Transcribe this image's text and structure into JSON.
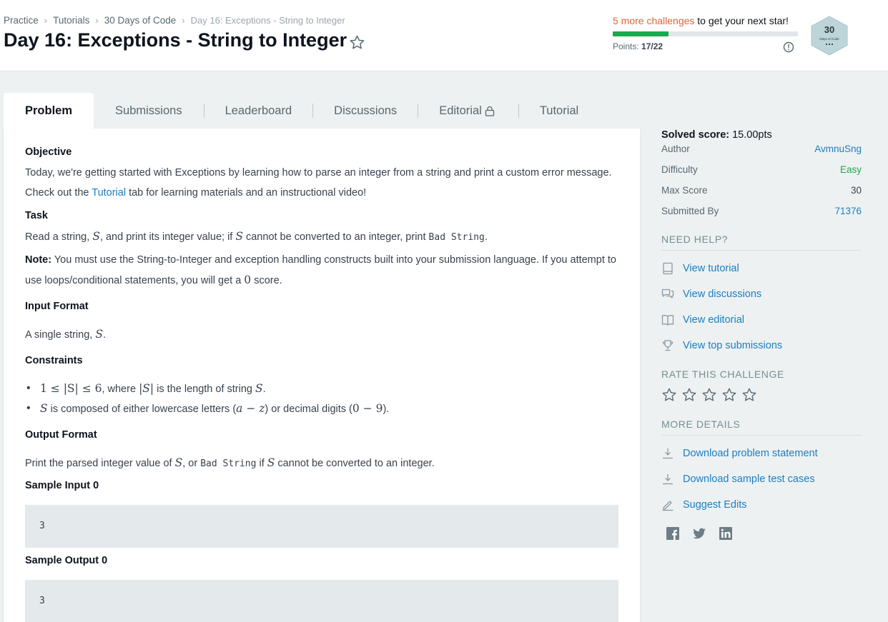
{
  "breadcrumb": [
    "Practice",
    "Tutorials",
    "30 Days of Code",
    "Day 16: Exceptions - String to Integer"
  ],
  "page_title": "Day 16: Exceptions - String to Integer",
  "star_progress": {
    "highlight": "5 more challenges",
    "rest": " to get your next star!",
    "points_label": "Points:",
    "points_value": "17/22",
    "fraction": 0.3
  },
  "badge": {
    "number": "30",
    "caption": "Days of Code"
  },
  "tabs": [
    "Problem",
    "Submissions",
    "Leaderboard",
    "Discussions",
    "Editorial",
    "Tutorial"
  ],
  "problem": {
    "objective_heading": "Objective",
    "objective_text_1": "Today, we're getting started with Exceptions by learning how to parse an integer from a string and print a custom error message. Check out the ",
    "objective_link": "Tutorial",
    "objective_text_2": " tab for learning materials and an instructional video!",
    "task_heading": "Task",
    "task_a": "Read a string, ",
    "task_s1": "S",
    "task_b": ", and print its integer value; if ",
    "task_s2": "S",
    "task_c": " cannot be converted to an integer, print ",
    "task_code": "Bad String",
    "task_d": ".",
    "note_label": "Note:",
    "note_a": " You must use the String-to-Integer and exception handling constructs built into your submission language. If you attempt to use loops/conditional statements, you will get a ",
    "note_zero": "0",
    "note_b": " score.",
    "input_heading": "Input Format",
    "input_a": "A single string, ",
    "input_s": "S",
    "input_b": ".",
    "constraints_heading": "Constraints",
    "c1_math": "1 ≤ |S| ≤ 6",
    "c1_a": ", where ",
    "c1_abs": "|S|",
    "c1_b": " is the length of string ",
    "c1_s": "S",
    "c1_c": ".",
    "c2_s": "S",
    "c2_a": " is composed of either lowercase letters (",
    "c2_m1": "a − z",
    "c2_b": ") or decimal digits (",
    "c2_m2": "0 − 9",
    "c2_c": ").",
    "output_heading": "Output Format",
    "out_a": "Print the parsed integer value of ",
    "out_s1": "S",
    "out_b": ", or ",
    "out_code": "Bad String",
    "out_c": " if ",
    "out_s2": "S",
    "out_d": " cannot be converted to an integer.",
    "sample_input_heading": "Sample Input 0",
    "sample_input": "3",
    "sample_output_heading": "Sample Output 0",
    "sample_output": "3"
  },
  "sidebar": {
    "solved_label": "Solved score:",
    "solved_value": " 15.00pts",
    "meta": [
      {
        "label": "Author",
        "value": "AvmnuSng",
        "style": "link"
      },
      {
        "label": "Difficulty",
        "value": "Easy",
        "style": "easy"
      },
      {
        "label": "Max Score",
        "value": "30",
        "style": "plain"
      },
      {
        "label": "Submitted By",
        "value": "71376",
        "style": "link"
      }
    ],
    "need_help": "NEED HELP?",
    "help_links": [
      "View tutorial",
      "View discussions",
      "View editorial",
      "View top submissions"
    ],
    "rate_heading": "RATE THIS CHALLENGE",
    "rating": 0,
    "more_details": "MORE DETAILS",
    "detail_links": [
      "Download problem statement",
      "Download sample test cases",
      "Suggest Edits"
    ],
    "social": [
      "facebook-icon",
      "twitter-icon",
      "linkedin-icon"
    ]
  },
  "colors": {
    "accent": "#1ba94c",
    "link": "#1a7fc1",
    "highlight": "#e2633e"
  }
}
